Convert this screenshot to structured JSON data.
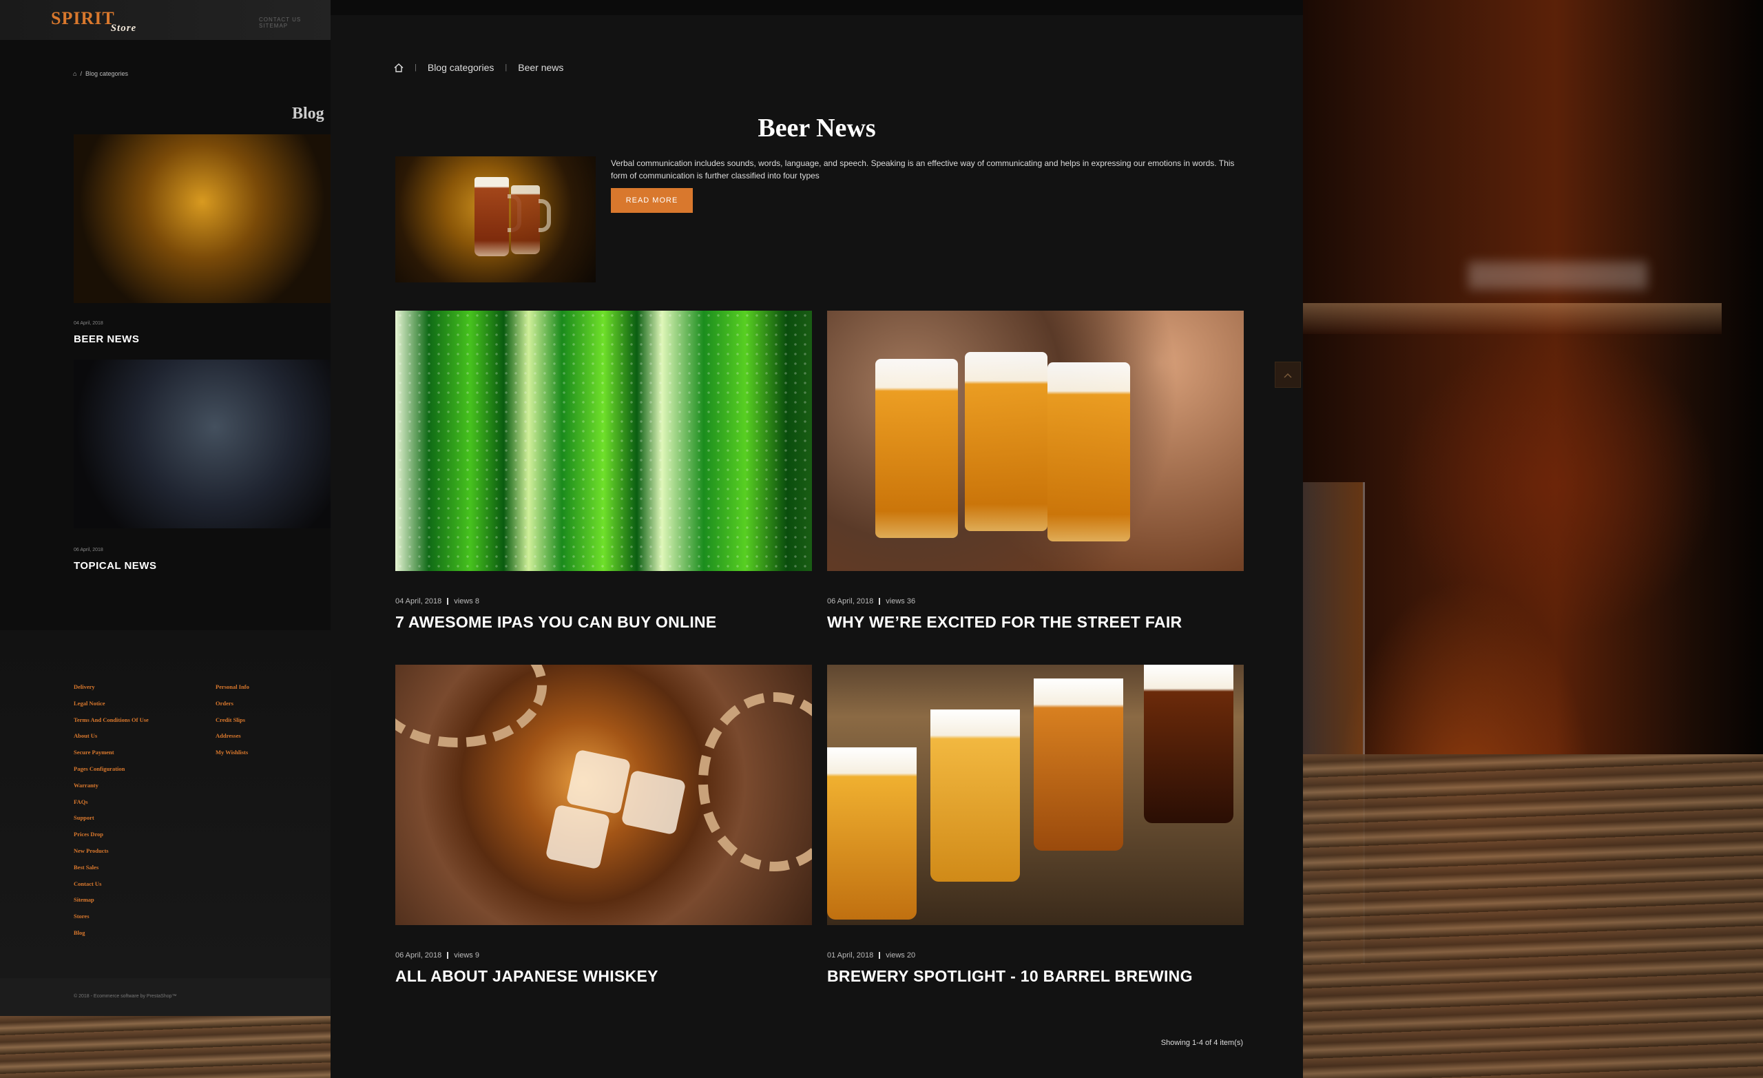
{
  "background_page": {
    "logo_main": "SPIRIT",
    "logo_sub": "Store",
    "top_links": "CONTACT US   SITEMAP",
    "breadcrumb_current": "Blog categories",
    "blog_title": "Blog",
    "posts": [
      {
        "date": "04 April, 2018",
        "title": "BEER NEWS"
      },
      {
        "date": "06 April, 2018",
        "title": "TOPICAL NEWS"
      }
    ],
    "footer_col1": [
      "Delivery",
      "Legal Notice",
      "Terms And Conditions Of Use",
      "About Us",
      "Secure Payment",
      "Pages Configuration",
      "Warranty",
      "FAQs",
      "Support",
      "Prices Drop",
      "New Products",
      "Best Sales",
      "Contact Us",
      "Sitemap",
      "Stores",
      "Blog"
    ],
    "footer_col2": [
      "Personal Info",
      "Orders",
      "Credit Slips",
      "Addresses",
      "My Wishlists"
    ],
    "copyright": "© 2018 - Ecommerce software by PrestaShop™"
  },
  "breadcrumb": {
    "items": [
      "Blog categories",
      "Beer news"
    ]
  },
  "category": {
    "title": "Beer News",
    "description": "Verbal communication includes sounds, words, language, and speech. Speaking is an effective way of communicating and helps in expressing our emotions in words. This form of communication is further classified into four types",
    "read_more": "READ MORE"
  },
  "posts": [
    {
      "date": "04 April, 2018",
      "views": "views 8",
      "title": "7 AWESOME IPAS YOU CAN BUY ONLINE"
    },
    {
      "date": "06 April, 2018",
      "views": "views 36",
      "title": "WHY WE’RE EXCITED FOR THE STREET FAIR"
    },
    {
      "date": "06 April, 2018",
      "views": "views 9",
      "title": "ALL ABOUT JAPANESE WHISKEY"
    },
    {
      "date": "01 April, 2018",
      "views": "views 20",
      "title": "BREWERY SPOTLIGHT - 10 BARREL BREWING"
    }
  ],
  "pagination": {
    "showing": "Showing 1-4 of 4 item(s)"
  },
  "icons": {
    "home": "home-icon",
    "scroll_top": "chevron-up-icon"
  },
  "colors": {
    "accent": "#d9782d",
    "panel": "#121212"
  }
}
